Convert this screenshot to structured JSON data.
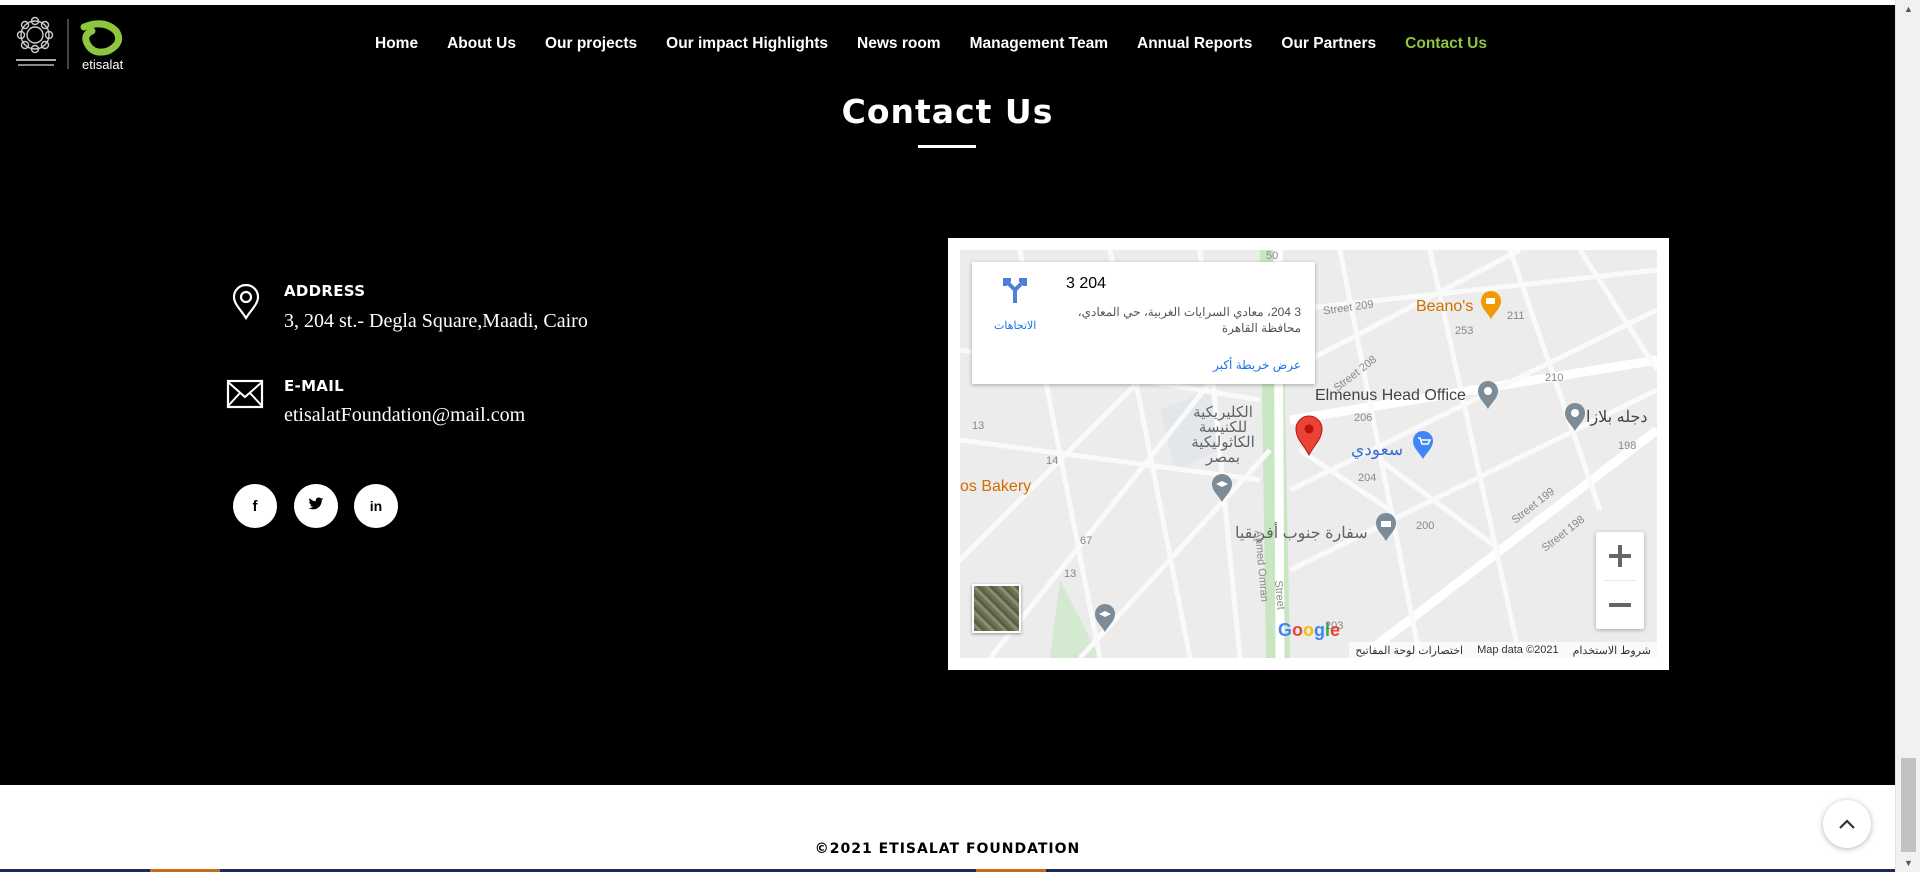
{
  "header": {
    "logo_text": "etisalat",
    "nav": [
      {
        "label": "Home"
      },
      {
        "label": "About Us"
      },
      {
        "label": "Our projects"
      },
      {
        "label": "Our impact Highlights"
      },
      {
        "label": "News room"
      },
      {
        "label": "Management Team"
      },
      {
        "label": "Annual Reports"
      },
      {
        "label": "Our Partners"
      },
      {
        "label": "Contact Us",
        "active": true
      }
    ]
  },
  "page_title": "Contact Us",
  "contact": {
    "address_label": "ADDRESS",
    "address_value": "3, 204 st.- Degla Square,Maadi, Cairo",
    "email_label": "E-MAIL",
    "email_value": "etisalatFoundation@mail.com"
  },
  "social": [
    {
      "name": "facebook",
      "glyph": "f"
    },
    {
      "name": "twitter",
      "glyph": "t"
    },
    {
      "name": "linkedin",
      "glyph": "in"
    }
  ],
  "map": {
    "card": {
      "place": "3 204",
      "address": "3 204، معادي السرايات الغربية، حي المعادي، محافظة القاهرة",
      "directions": "الاتجاهات",
      "bigger_map": "عرض خريطة أكبر"
    },
    "labels": {
      "beanos": "Beano's",
      "elmenus": "Elmenus Head Office",
      "degla_plaza": "دجله بلازا",
      "saudi": "سعودي",
      "bakery": "os Bakery",
      "church": "الكليريكية للكنيسة الكاثوليكية بمصر",
      "embassy": "سفارة جنوب أفريقيا",
      "ahmed_omran": "Ahmed Omran",
      "street_209": "Street 209",
      "street_208": "Street 208",
      "street_199": "Street 199",
      "street_198": "Street 198",
      "street_label": "Street",
      "n_206": "206",
      "n_204": "204",
      "n_203": "203",
      "n_200": "200",
      "n_210": "210",
      "n_211": "211",
      "n_253": "253",
      "n_13": "13",
      "n_14": "14",
      "n_67": "67",
      "n_13b": "13",
      "n_198": "198",
      "n_50": "50"
    },
    "footer": {
      "shortcuts": "اختصارات لوحة المفاتيح",
      "map_data": "Map data ©2021",
      "terms": "شروط الاستخدام"
    },
    "google": "Google"
  },
  "footer": {
    "copyright": "©2021 ETISALAT FOUNDATION"
  },
  "colors": {
    "accent": "#8dc63f",
    "background": "#000000",
    "pin": "#ea4335"
  }
}
